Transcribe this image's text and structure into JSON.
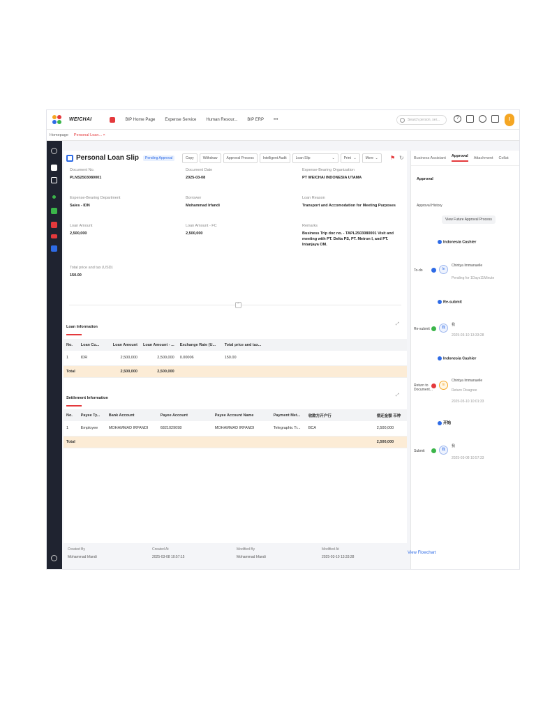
{
  "app": {
    "brand": "WEICHAI",
    "nav": [
      "BIP Home Page",
      "Expense Service",
      "Human Resour...",
      "BIP ERP",
      "•••"
    ],
    "search_placeholder": "Search person, ser...",
    "avatar_initial": "I",
    "breadcrumb": [
      "Homepage",
      "Personal Loan... ×"
    ]
  },
  "doc": {
    "title": "Personal Loan Slip",
    "status": "Pending Approval",
    "buttons": [
      "Copy",
      "Withdraw",
      "Approval Process",
      "Intelligent Audit"
    ],
    "print_template": "Loan Slip",
    "print_label": "Print",
    "more_label": "More",
    "fields": {
      "document_no": {
        "label": "Document No.",
        "value": "PLNS2503080001"
      },
      "document_date": {
        "label": "Document Date",
        "value": "2025-03-08"
      },
      "org": {
        "label": "Expense-Bearing Organization",
        "value": "PT WEICHAI INDONESIA UTAMA"
      },
      "dept": {
        "label": "Expense-Bearing Department",
        "value": "Sales - IDN"
      },
      "borrower": {
        "label": "Borrower",
        "value": "Mohammad Irfandi"
      },
      "reason": {
        "label": "Loan Reason",
        "value": "Transport and Accomodation for Meeting Purposes"
      },
      "loan_amount": {
        "label": "Loan Amount",
        "value": "2,500,000"
      },
      "loan_amount_fc": {
        "label": "Loan Amount - FC",
        "value": "2,500,000"
      },
      "remarks": {
        "label": "Remarks",
        "value": "Business Trip doc no. - TAPL2503080001 Visit and meeting with PT. Delta PS, PT. Metron I, and PT. Intanjaya OM."
      },
      "total_tax": {
        "label": "Total price and tax (USD)",
        "value": "150.00"
      }
    }
  },
  "loan_info": {
    "title": "Loan Information",
    "headers": [
      "No.",
      "Loan Cu...",
      "Loan Amount",
      "Loan Amount - ...",
      "Exchange Rate (U...",
      "Total price and tax..."
    ],
    "rows": [
      [
        "1",
        "IDR",
        "2,500,000",
        "2,500,000",
        "0.00006",
        "150.00"
      ]
    ],
    "total": [
      "Total",
      "",
      "2,500,000",
      "2,500,000",
      "",
      ""
    ]
  },
  "settlement": {
    "title": "Settlement Information",
    "headers": [
      "No.",
      "Payee Ty...",
      "Bank Account",
      "Payee Account",
      "Payee Account Name",
      "Payment Met...",
      "收款方开户行",
      "偿还金额 币种"
    ],
    "rows": [
      [
        "1",
        "Employee",
        "MOHAMMAD IRFANDI",
        "6821029098",
        "MOHAMMAD IRFANDI",
        "Telegraphic Tr...",
        "BCA",
        "2,500,000"
      ]
    ],
    "total": [
      "Total",
      "",
      "",
      "",
      "",
      "",
      "",
      "2,500,000"
    ]
  },
  "footer": {
    "created_by": {
      "label": "Created By",
      "value": "Mohammad Irfandi"
    },
    "created_at": {
      "label": "Created At",
      "value": "2025-03-08 10:57:15"
    },
    "modified_by": {
      "label": "Modified By",
      "value": "Mohammad Irfandi"
    },
    "modified_at": {
      "label": "Modified At",
      "value": "2025-03-10 13:33:28"
    }
  },
  "approval": {
    "tabs": [
      "Business Assistant",
      "Approval",
      "Attachment",
      "Collat"
    ],
    "heading": "Approval",
    "history_label": "Approval History",
    "future_label": "View Future Approval Process",
    "nodes": [
      {
        "name": "Indonesia Cashier",
        "status": "To-do",
        "person": "Chintya Immanuelle",
        "note": "Pending for 1Days11Minute",
        "avatar": "In"
      },
      {
        "name": "Re-submit",
        "status": "Re-submit",
        "person": "我",
        "note": "2025-03-10 13:33:28",
        "avatar": "我"
      },
      {
        "name": "Indonesia Cashier",
        "status": "Return to Document...",
        "person": "Chintya Immanuelle",
        "note": "Return Disagree",
        "time": "2025-03-10 10:01:33",
        "avatar": "In"
      },
      {
        "name": "开始",
        "status": "Submit",
        "person": "我",
        "note": "2025-03-08 10:57:33",
        "avatar": "我"
      }
    ],
    "flowchart_label": "View Flowchart"
  },
  "colors": {
    "accent": "#e4393c",
    "primary": "#2e6be6",
    "total_row": "#fcecd6",
    "sidebar": "#1f2330"
  }
}
